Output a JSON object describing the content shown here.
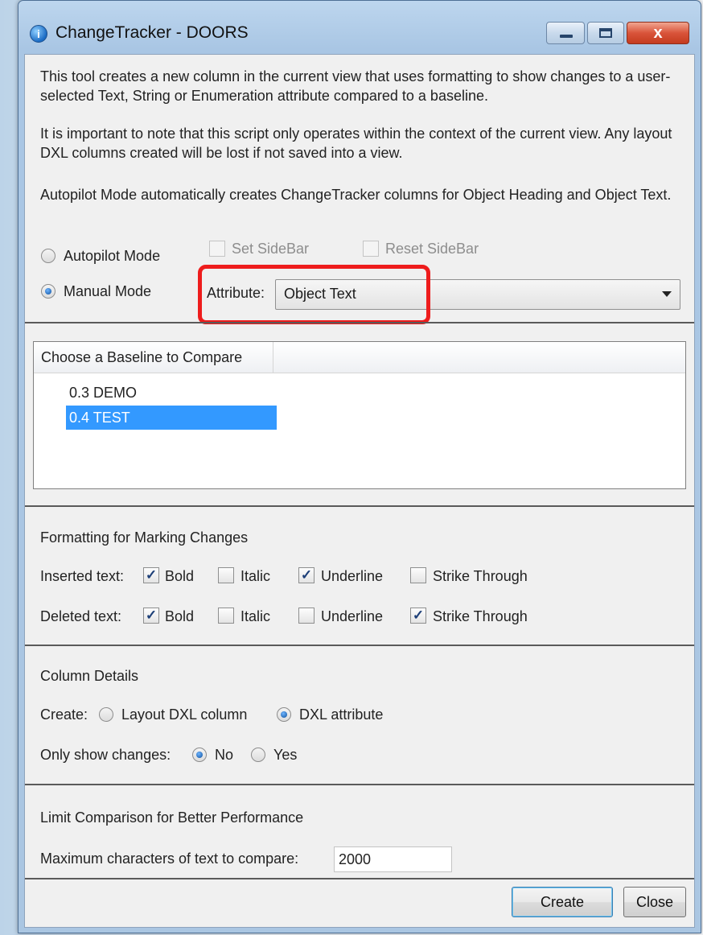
{
  "window": {
    "title": "ChangeTracker - DOORS",
    "icon": "doors-app-icon",
    "controls": {
      "close_glyph": "x"
    }
  },
  "intro": {
    "p1": "This tool creates a new column in the current view that uses formatting to show changes to a user-selected Text, String or Enumeration attribute compared to a baseline.",
    "p2": "It is important to note that this script only operates within the context of the current view. Any layout DXL columns created will be lost if not saved into a view.",
    "p3": "Autopilot Mode automatically creates ChangeTracker columns for Object Heading and Object Text."
  },
  "mode": {
    "autopilot_label": "Autopilot Mode",
    "manual_label": "Manual Mode",
    "selected": "manual",
    "set_sidebar_label": "Set SideBar",
    "reset_sidebar_label": "Reset SideBar",
    "attribute_label": "Attribute:",
    "attribute_value": "Object Text"
  },
  "baseline": {
    "header": "Choose a Baseline to Compare",
    "items": [
      "0.3 DEMO",
      "0.4 TEST"
    ],
    "selected_index": 1
  },
  "formatting": {
    "heading": "Formatting for Marking Changes",
    "inserted_label": "Inserted text:",
    "deleted_label": "Deleted text:",
    "options": [
      "Bold",
      "Italic",
      "Underline",
      "Strike Through"
    ],
    "inserted_checked": [
      true,
      false,
      true,
      false
    ],
    "deleted_checked": [
      true,
      false,
      false,
      true
    ],
    "check_glyph": "✓"
  },
  "column": {
    "heading": "Column Details",
    "create_label": "Create:",
    "layout_dxl_label": "Layout DXL column",
    "dxl_attribute_label": "DXL attribute",
    "create_selected": "dxl_attribute",
    "only_changes_label": "Only show changes:",
    "no_label": "No",
    "yes_label": "Yes",
    "only_changes_selected": "no"
  },
  "limit": {
    "heading": "Limit Comparison for Better Performance",
    "max_chars_label": "Maximum characters of text to compare:",
    "max_chars_value": "2000"
  },
  "buttons": {
    "create": "Create",
    "close": "Close"
  },
  "colors": {
    "highlight_box": "#ee1c1c",
    "selection": "#3399ff",
    "dialog_bg": "#f0f0f0"
  }
}
